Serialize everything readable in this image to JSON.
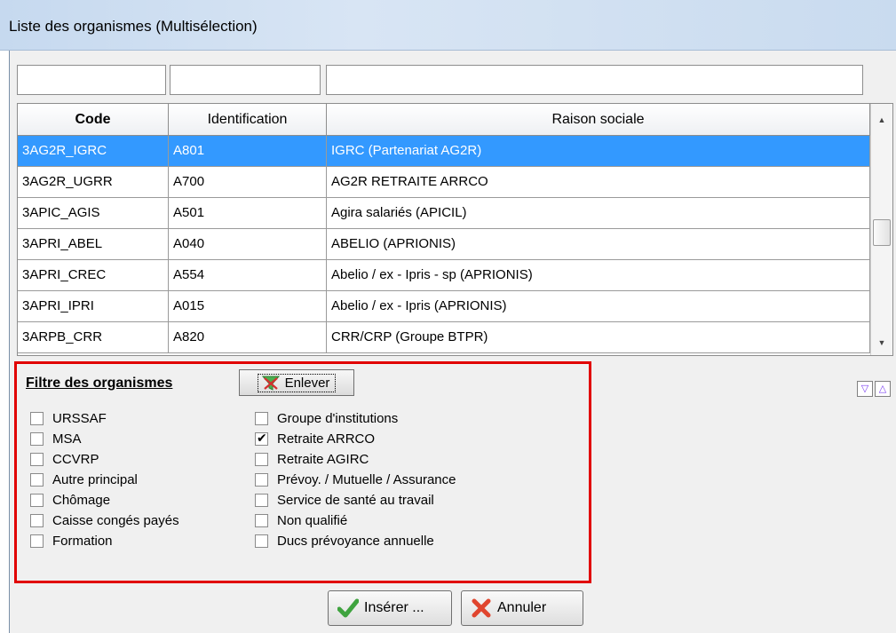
{
  "window": {
    "title": "Liste des organismes (Multisélection)"
  },
  "filters": {
    "code_value": "",
    "identification_value": "",
    "raison_value": ""
  },
  "grid": {
    "columns": [
      "Code",
      "Identification",
      "Raison sociale"
    ],
    "rows": [
      {
        "code": "3AG2R_IGRC",
        "identification": "A801",
        "raison": "IGRC (Partenariat AG2R)",
        "selected": true
      },
      {
        "code": "3AG2R_UGRR",
        "identification": "A700",
        "raison": "AG2R RETRAITE ARRCO"
      },
      {
        "code": "3APIC_AGIS",
        "identification": "A501",
        "raison": "Agira salariés (APICIL)"
      },
      {
        "code": "3APRI_ABEL",
        "identification": "A040",
        "raison": "ABELIO (APRIONIS)"
      },
      {
        "code": "3APRI_CREC",
        "identification": "A554",
        "raison": "Abelio / ex - Ipris - sp (APRIONIS)"
      },
      {
        "code": "3APRI_IPRI",
        "identification": "A015",
        "raison": "Abelio / ex - Ipris (APRIONIS)"
      },
      {
        "code": "3ARPB_CRR",
        "identification": "A820",
        "raison": "CRR/CRP (Groupe BTPR)"
      }
    ]
  },
  "filter_panel": {
    "title": "Filtre des organismes",
    "remove_label": "Enlever",
    "left": [
      {
        "label": "URSSAF",
        "checked": false
      },
      {
        "label": "MSA",
        "checked": false
      },
      {
        "label": "CCVRP",
        "checked": false
      },
      {
        "label": "Autre principal",
        "checked": false
      },
      {
        "label": "Chômage",
        "checked": false
      },
      {
        "label": "Caisse congés payés",
        "checked": false
      },
      {
        "label": "Formation",
        "checked": false
      }
    ],
    "right": [
      {
        "label": "Groupe d'institutions",
        "checked": false
      },
      {
        "label": "Retraite ARRCO",
        "checked": true
      },
      {
        "label": "Retraite AGIRC",
        "checked": false
      },
      {
        "label": "Prévoy. / Mutuelle / Assurance",
        "checked": false
      },
      {
        "label": "Service de santé au travail",
        "checked": false
      },
      {
        "label": "Non qualifié",
        "checked": false
      },
      {
        "label": "Ducs prévoyance annuelle",
        "checked": false
      }
    ]
  },
  "actions": {
    "insert_label": "Insérer ...",
    "cancel_label": "Annuler"
  },
  "colors": {
    "selection": "#3399ff",
    "highlight_border": "#e10000"
  }
}
